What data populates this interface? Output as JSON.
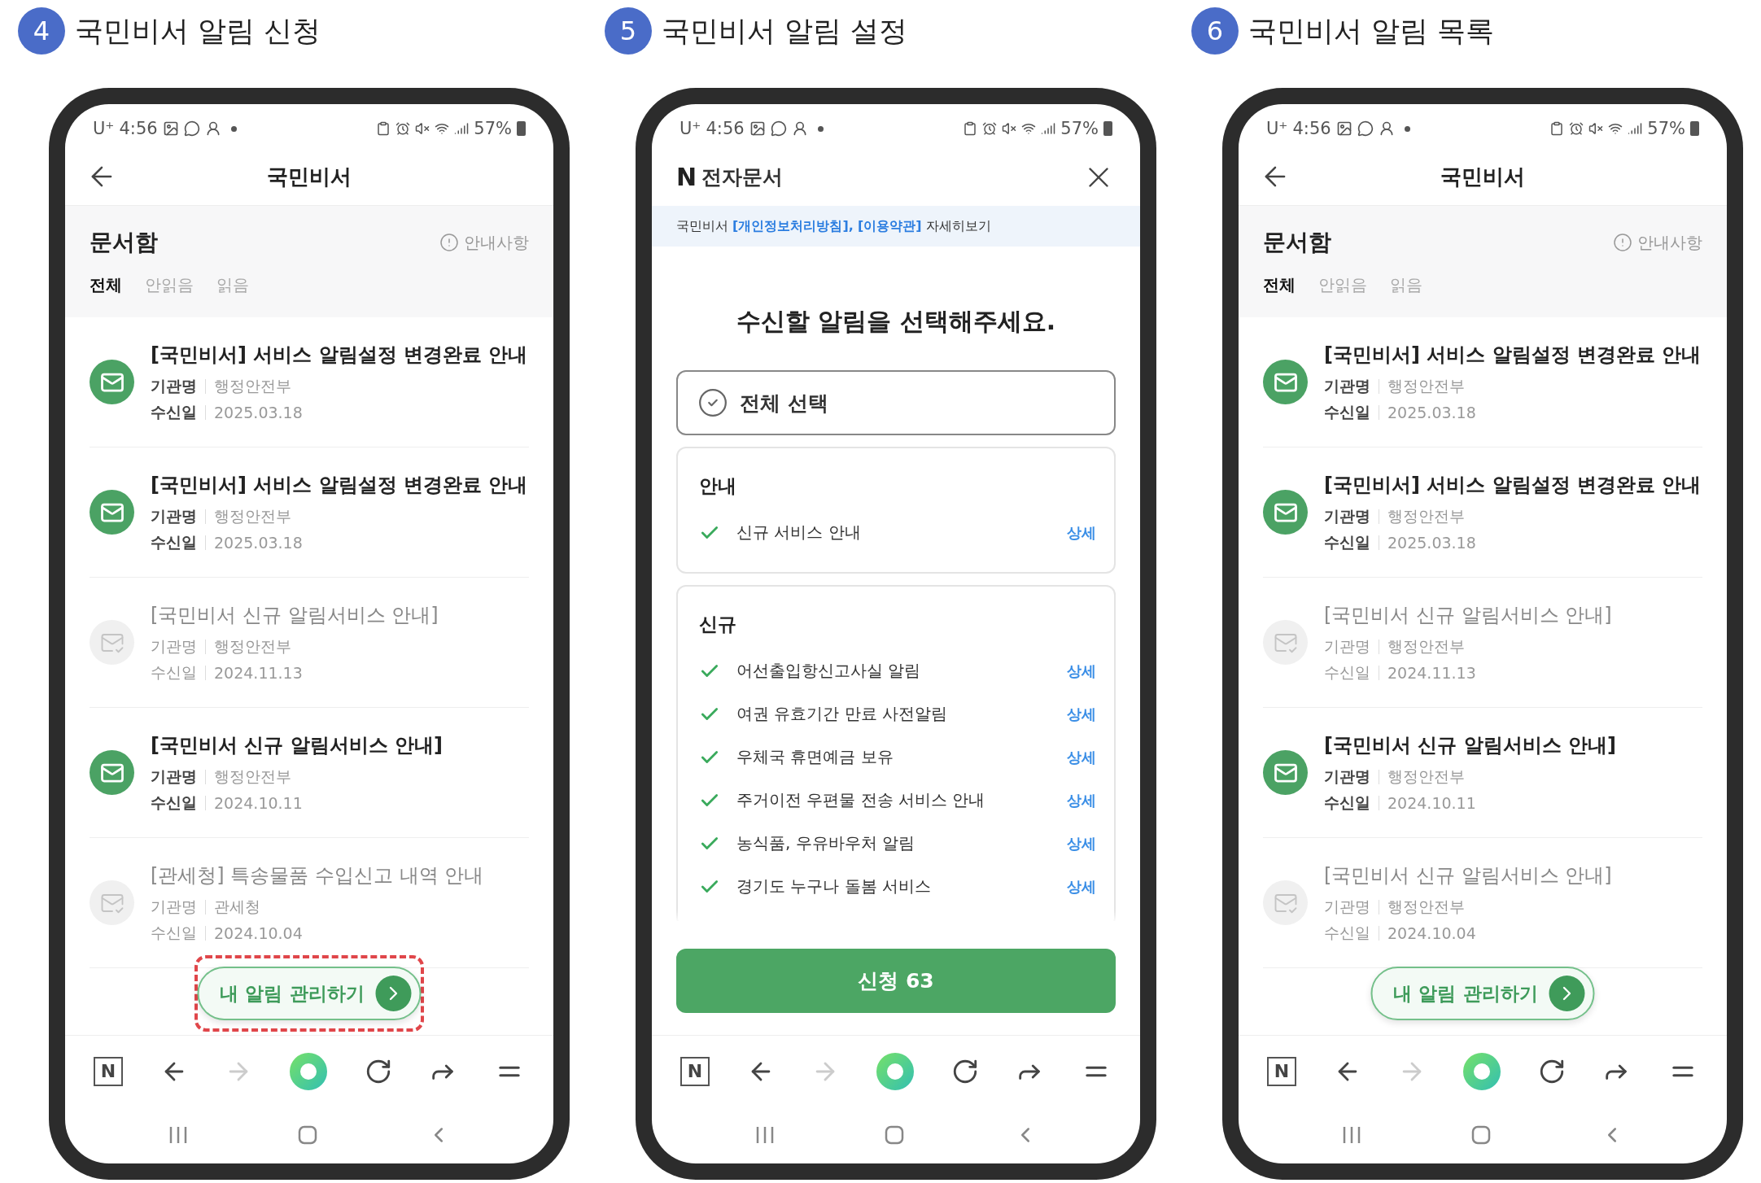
{
  "panels": [
    {
      "step": "4",
      "caption": "국민비서 알림 신청",
      "highlight_fab": true,
      "status": {
        "carrier": "U⁺",
        "time": "4:56",
        "battery": "57%"
      },
      "screen": {
        "kind": "inbox",
        "nav_title": "국민비서",
        "section_title": "문서함",
        "notice": "안내사항",
        "tabs": [
          {
            "label": "전체",
            "selected": true
          },
          {
            "label": "안읽음",
            "selected": false
          },
          {
            "label": "읽음",
            "selected": false
          }
        ],
        "documents": [
          {
            "title": "[국민비서] 서비스 알림설정 변경완료 안내",
            "agency_label": "기관명",
            "agency": "행정안전부",
            "date_label": "수신일",
            "date": "2025.03.18",
            "read": false
          },
          {
            "title": "[국민비서] 서비스 알림설정 변경완료 안내",
            "agency_label": "기관명",
            "agency": "행정안전부",
            "date_label": "수신일",
            "date": "2025.03.18",
            "read": false
          },
          {
            "title": "[국민비서 신규 알림서비스 안내]",
            "agency_label": "기관명",
            "agency": "행정안전부",
            "date_label": "수신일",
            "date": "2024.11.13",
            "read": true
          },
          {
            "title": "[국민비서 신규 알림서비스 안내]",
            "agency_label": "기관명",
            "agency": "행정안전부",
            "date_label": "수신일",
            "date": "2024.10.11",
            "read": false
          },
          {
            "title": "[관세청] 특송물품 수입신고 내역 안내",
            "agency_label": "기관명",
            "agency": "관세청",
            "date_label": "수신일",
            "date": "2024.10.04",
            "read": true
          }
        ],
        "fab": "내 알림 관리하기"
      },
      "toolbar": {
        "home": "N",
        "forward_disabled": true
      }
    },
    {
      "step": "5",
      "caption": "국민비서 알림 설정",
      "highlight_fab": false,
      "status": {
        "carrier": "U⁺",
        "time": "4:56",
        "battery": "57%"
      },
      "screen": {
        "kind": "settings",
        "brand": "N",
        "nav_title": "전자문서",
        "banner": {
          "prefix": "국민비서",
          "link_1": "[개인정보처리방침],",
          "link_2": "[이용약관]",
          "suffix": "자세히보기"
        },
        "heading": "수신할 알림을 선택해주세요.",
        "select_all": {
          "label": "전체 선택",
          "checked": true
        },
        "groups": [
          {
            "title": "안내",
            "items": [
              {
                "label": "신규 서비스 안내",
                "checked": true,
                "detail": "상세"
              }
            ]
          },
          {
            "title": "신규",
            "items": [
              {
                "label": "어선출입항신고사실 알림",
                "checked": true,
                "detail": "상세"
              },
              {
                "label": "여권 유효기간 만료 사전알림",
                "checked": true,
                "detail": "상세"
              },
              {
                "label": "우체국 휴면예금 보유",
                "checked": true,
                "detail": "상세"
              },
              {
                "label": "주거이전 우편물 전송 서비스 안내",
                "checked": true,
                "detail": "상세"
              },
              {
                "label": "농식품, 우유바우처 알림",
                "checked": true,
                "detail": "상세"
              },
              {
                "label": "경기도 누구나 돌봄 서비스",
                "checked": true,
                "detail": "상세"
              }
            ]
          }
        ],
        "submit": "신청 63"
      },
      "toolbar": {
        "home": "N",
        "forward_disabled": true
      }
    },
    {
      "step": "6",
      "caption": "국민비서 알림 목록",
      "highlight_fab": false,
      "status": {
        "carrier": "U⁺",
        "time": "4:56",
        "battery": "57%"
      },
      "screen": {
        "kind": "inbox",
        "nav_title": "국민비서",
        "section_title": "문서함",
        "notice": "안내사항",
        "tabs": [
          {
            "label": "전체",
            "selected": true
          },
          {
            "label": "안읽음",
            "selected": false
          },
          {
            "label": "읽음",
            "selected": false
          }
        ],
        "documents": [
          {
            "title": "[국민비서] 서비스 알림설정 변경완료 안내",
            "agency_label": "기관명",
            "agency": "행정안전부",
            "date_label": "수신일",
            "date": "2025.03.18",
            "read": false
          },
          {
            "title": "[국민비서] 서비스 알림설정 변경완료 안내",
            "agency_label": "기관명",
            "agency": "행정안전부",
            "date_label": "수신일",
            "date": "2025.03.18",
            "read": false
          },
          {
            "title": "[국민비서 신규 알림서비스 안내]",
            "agency_label": "기관명",
            "agency": "행정안전부",
            "date_label": "수신일",
            "date": "2024.11.13",
            "read": true
          },
          {
            "title": "[국민비서 신규 알림서비스 안내]",
            "agency_label": "기관명",
            "agency": "행정안전부",
            "date_label": "수신일",
            "date": "2024.10.11",
            "read": false
          },
          {
            "title": "[국민비서 신규 알림서비스 안내]",
            "agency_label": "기관명",
            "agency": "행정안전부",
            "date_label": "수신일",
            "date": "2024.10.04",
            "read": true
          }
        ],
        "fab": "내 알림 관리하기"
      },
      "toolbar": {
        "home": "N",
        "forward_disabled": true
      }
    }
  ]
}
